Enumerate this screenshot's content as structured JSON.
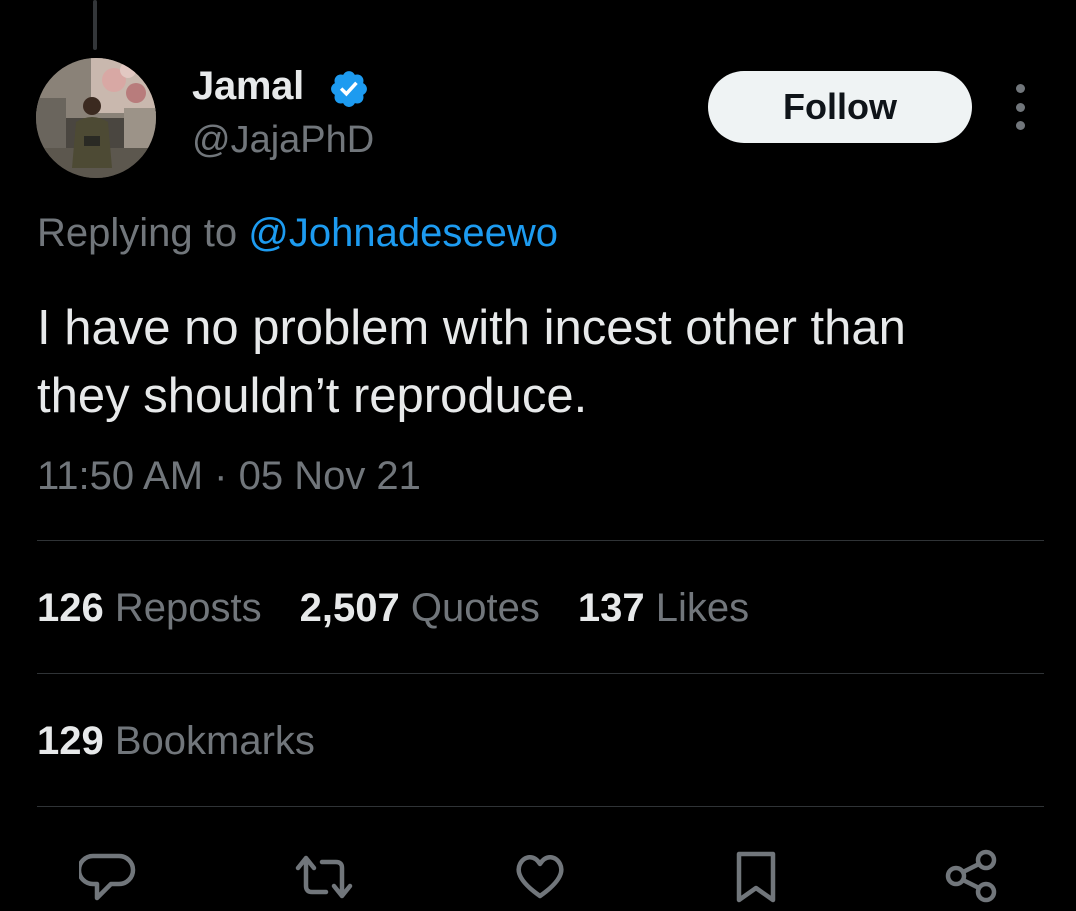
{
  "author": {
    "name": "Jamal",
    "handle": "@JajaPhD",
    "verified": true,
    "avatar": "person-photo-avatar"
  },
  "follow_button": {
    "label": "Follow"
  },
  "more_menu": {
    "icon": "more-vertical-icon"
  },
  "reply": {
    "prefix": "Replying to",
    "mention": "@Johnadeseewo"
  },
  "tweet": {
    "text": "I have no problem with incest other than\nthey shouldn’t reproduce.",
    "timestamp": "11:50 AM · 05 Nov 21"
  },
  "stats": {
    "reposts": {
      "count": "126",
      "label": "Reposts"
    },
    "quotes": {
      "count": "2,507",
      "label": "Quotes"
    },
    "likes": {
      "count": "137",
      "label": "Likes"
    },
    "bookmarks": {
      "count": "129",
      "label": "Bookmarks"
    }
  },
  "actions": [
    {
      "name": "reply",
      "icon": "reply-icon"
    },
    {
      "name": "repost",
      "icon": "repost-icon"
    },
    {
      "name": "like",
      "icon": "heart-icon"
    },
    {
      "name": "bookmark",
      "icon": "bookmark-icon"
    },
    {
      "name": "share",
      "icon": "share-icon"
    }
  ],
  "colors": {
    "background": "#000000",
    "text_primary": "#e7e9ea",
    "text_secondary": "#71767b",
    "accent": "#1d9bf0",
    "verified_badge": "#1d9bf0",
    "divider": "#2f3336",
    "follow_button_bg": "#eff3f4"
  }
}
